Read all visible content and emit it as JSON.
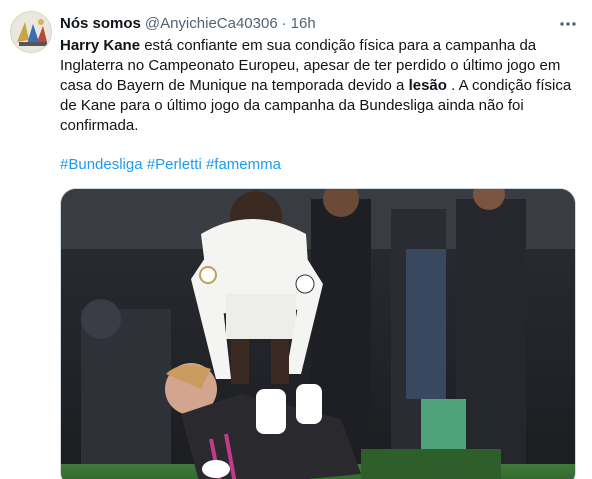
{
  "tweet": {
    "display_name": "Nós somos",
    "handle": "@AnyichieCa40306",
    "separator": "·",
    "time": "16h",
    "body_bold_lead": "Harry Kane",
    "body_part1": " está confiante em sua condição física para a campanha da Inglaterra no Campeonato Europeu, apesar de ter perdido o último jogo em casa do Bayern de Munique na temporada devido a ",
    "body_bold_mid": "lesão",
    "body_part2": " . A condição física de Kane para o último jogo da campanha da Bundesliga ainda não foi confirmada.",
    "hashtags": [
      "#Bundesliga",
      "#Perletti",
      "#famemma"
    ],
    "media_alt": "Jogador do Real Madrid ajudando Harry Kane caído no gramado"
  },
  "icons": {
    "more": "more-horizontal-icon",
    "avatar": "profile-avatar"
  },
  "colors": {
    "link": "#1d9bf0",
    "secondary_text": "#536471",
    "primary_text": "#0f1419"
  }
}
